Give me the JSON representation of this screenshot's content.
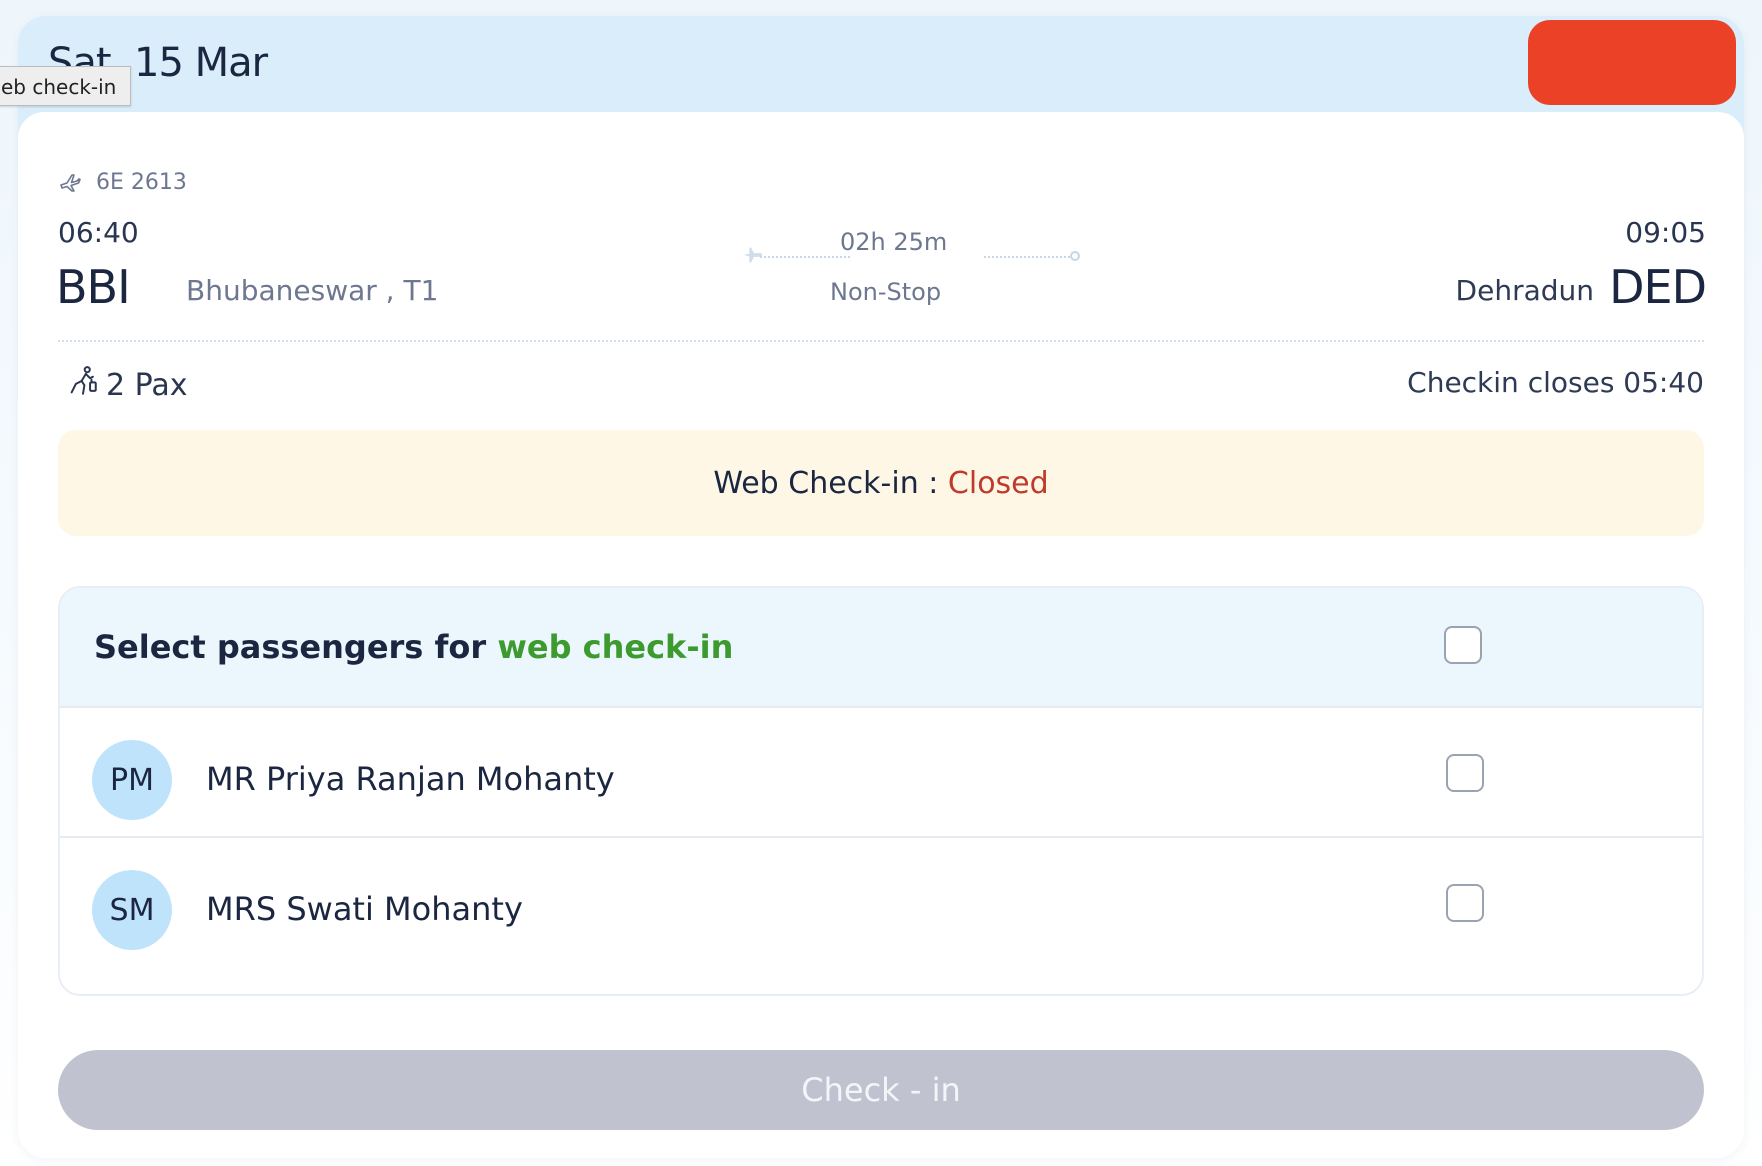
{
  "header": {
    "date": "Sat, 15 Mar"
  },
  "tooltip": {
    "text": "eb check-in"
  },
  "flight": {
    "number": "6E 2613",
    "depart_time": "06:40",
    "arrive_time": "09:05",
    "origin_code": "BBI",
    "origin_city": "Bhubaneswar , T1",
    "dest_code": "DED",
    "dest_city": "Dehradun",
    "duration": "02h 25m",
    "stops": "Non-Stop"
  },
  "pax_count": "2 Pax",
  "checkin_closes": "Checkin closes 05:40",
  "status": {
    "label": "Web Check-in : ",
    "value": "Closed"
  },
  "select_panel": {
    "title_prefix": "Select passengers for ",
    "title_accent": "web check-in",
    "passengers": [
      {
        "initials": "PM",
        "name": "MR Priya Ranjan Mohanty"
      },
      {
        "initials": "SM",
        "name": "MRS Swati Mohanty"
      }
    ]
  },
  "checkin_button": "Check - in",
  "colors": {
    "header_band": "#d9edfb",
    "action_button": "#ea4127",
    "status_bg": "#fef7e6",
    "closed_text": "#c0392b",
    "accent_green": "#3c9a2e",
    "avatar_bg": "#bfe3fb",
    "disabled_button": "#c0c3cf"
  },
  "icons": {
    "flight": "airplane-icon",
    "pax": "walking-traveler-icon",
    "route": "airplane-icon"
  }
}
